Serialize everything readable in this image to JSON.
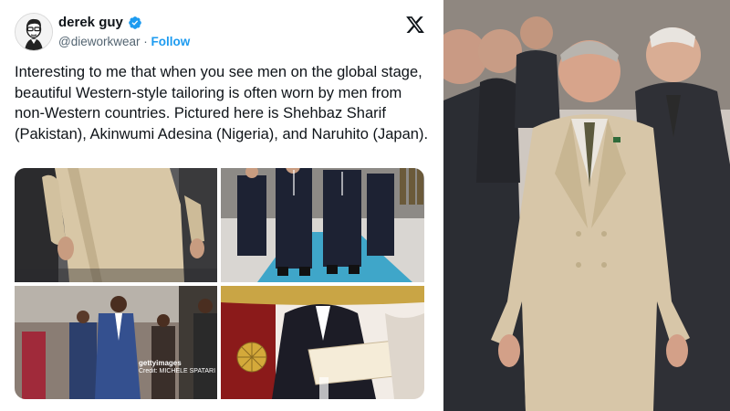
{
  "tweet": {
    "author_name": "derek guy",
    "handle": "@dieworkwear",
    "separator": " · ",
    "follow_label": "Follow",
    "text": "Interesting to me that when you see men on the global stage, beautiful Western-style tailoring is often worn by men from non-Western countries. Pictured here is Shehbaz Sharif (Pakistan), Akinwumi Adesina (Nigeria), and Naruhito (Japan).",
    "verified_icon": "verified-badge-icon",
    "platform_icon": "x-logo-icon",
    "accent_color": "#1d9bf0",
    "media": [
      {
        "name": "photo-beige-suit"
      },
      {
        "name": "photo-walking-dark-suits"
      },
      {
        "name": "photo-blue-suit-walking",
        "watermark": "gettyimages",
        "credit": "Credit: MICHELE SPATARI"
      },
      {
        "name": "photo-tailcoat-ceremony"
      }
    ]
  },
  "large_photo": {
    "name": "photo-double-breasted-beige-suit"
  }
}
